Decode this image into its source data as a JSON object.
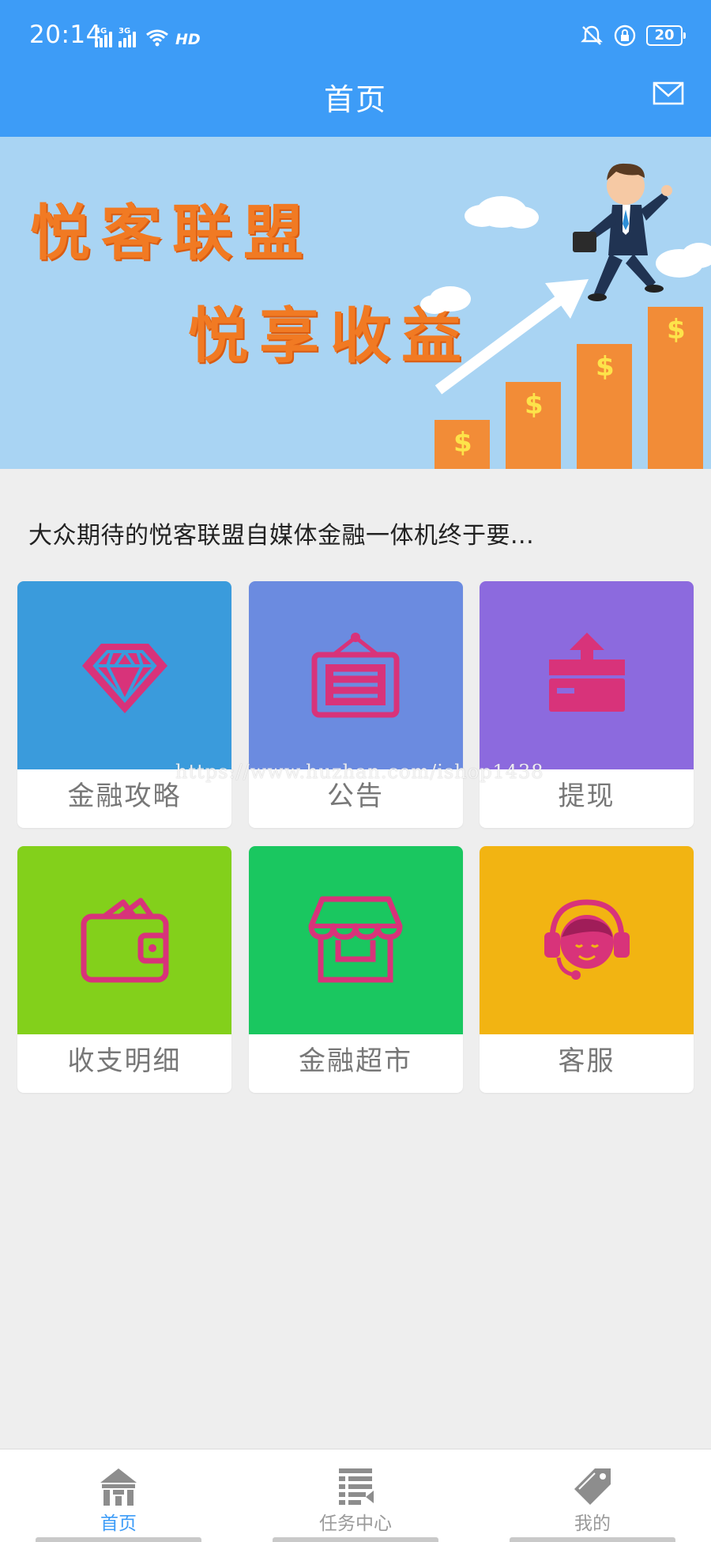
{
  "status_bar": {
    "time": "20:14",
    "signal_1_tag": "4G",
    "signal_2_tag": "3G",
    "hd_label": "HD",
    "battery": "20",
    "icons": [
      "bell-muted-icon",
      "lock-rotation-icon",
      "battery-icon",
      "wifi-icon"
    ]
  },
  "header": {
    "title": "首页",
    "mail_icon": "mail-icon"
  },
  "banner": {
    "line1": "悦客联盟",
    "line2": "悦享收益",
    "slide_count": 3,
    "active_slide": 1
  },
  "notice": "大众期待的悦客联盟自媒体金融一体机终于要...",
  "grid": {
    "tiles": [
      {
        "label": "金融攻略",
        "icon": "diamond-icon",
        "color": "#3a9bdc"
      },
      {
        "label": "公告",
        "icon": "notice-board-icon",
        "color": "#6b8be0"
      },
      {
        "label": "提现",
        "icon": "withdraw-card-icon",
        "color": "#8c6ade"
      },
      {
        "label": "收支明细",
        "icon": "wallet-icon",
        "color": "#83d01b"
      },
      {
        "label": "金融超市",
        "icon": "store-icon",
        "color": "#1ac760"
      },
      {
        "label": "客服",
        "icon": "customer-service-icon",
        "color": "#f2b412"
      }
    ],
    "icon_color": "#d8337a"
  },
  "watermark": "https://www.huzhan.com/ishop1438",
  "bottom_nav": {
    "items": [
      {
        "label": "首页",
        "icon": "home-icon",
        "active": true
      },
      {
        "label": "任务中心",
        "icon": "task-list-icon",
        "active": false
      },
      {
        "label": "我的",
        "icon": "tag-icon",
        "active": false
      }
    ]
  },
  "colors": {
    "header": "#3d9cf7",
    "page_bg": "#eeeeee",
    "active_nav": "#3d9cf7",
    "inactive_nav": "#9a9a9a"
  }
}
